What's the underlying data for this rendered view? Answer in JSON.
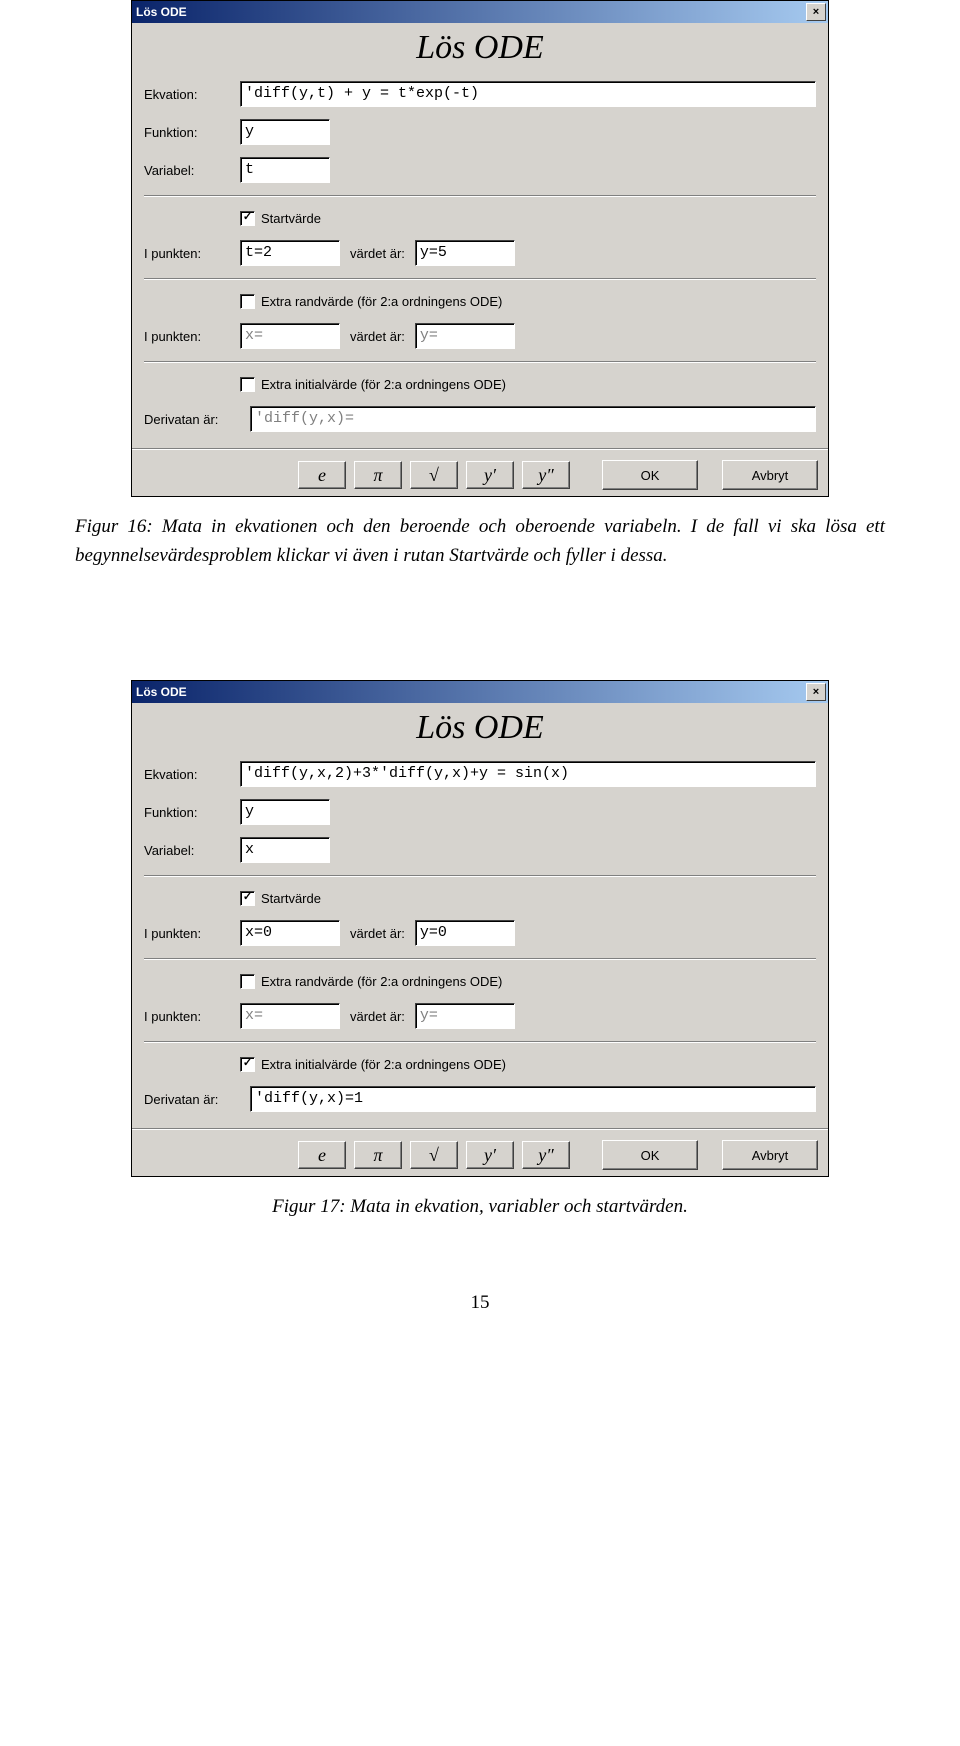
{
  "dlg1": {
    "title": "Lös ODE",
    "close": "×",
    "heading": "Lös ODE",
    "labels": {
      "ekvation": "Ekvation:",
      "funktion": "Funktion:",
      "variabel": "Variabel:",
      "ipunkten": "I punkten:",
      "vardet": "värdet är:",
      "derivatan": "Derivatan är:"
    },
    "ekvation": "'diff(y,t) + y = t*exp(-t)",
    "funktion": "y",
    "variabel": "t",
    "startvarde": "Startvärde",
    "startvarde_checked": "✓",
    "pt1": "t=2",
    "val1": "y=5",
    "extra_rand": "Extra randvärde (för 2:a ordningens ODE)",
    "extra_rand_checked": "",
    "pt2": "x=",
    "val2": "y=",
    "extra_init": "Extra initialvärde (för 2:a ordningens ODE)",
    "extra_init_checked": "",
    "derivatan": "'diff(y,x)=",
    "buttons": {
      "e": "e",
      "pi": "π",
      "sqrt": "√",
      "yp": "y′",
      "ypp": "y″",
      "ok": "OK",
      "cancel": "Avbryt"
    }
  },
  "caption1": "Figur 16: Mata in ekvationen och den beroende och oberoende variabeln. I de fall vi ska lösa ett begynnelsevärdesproblem klickar vi även i rutan Startvärde och fyller i dessa.",
  "dlg2": {
    "title": "Lös ODE",
    "close": "×",
    "heading": "Lös ODE",
    "labels": {
      "ekvation": "Ekvation:",
      "funktion": "Funktion:",
      "variabel": "Variabel:",
      "ipunkten": "I punkten:",
      "vardet": "värdet är:",
      "derivatan": "Derivatan är:"
    },
    "ekvation": "'diff(y,x,2)+3*'diff(y,x)+y = sin(x)",
    "funktion": "y",
    "variabel": "x",
    "startvarde": "Startvärde",
    "startvarde_checked": "✓",
    "pt1": "x=0",
    "val1": "y=0",
    "extra_rand": "Extra randvärde (för 2:a ordningens ODE)",
    "extra_rand_checked": "",
    "pt2": "x=",
    "val2": "y=",
    "extra_init": "Extra initialvärde (för 2:a ordningens ODE)",
    "extra_init_checked": "✓",
    "derivatan": "'diff(y,x)=1",
    "buttons": {
      "e": "e",
      "pi": "π",
      "sqrt": "√",
      "yp": "y′",
      "ypp": "y″",
      "ok": "OK",
      "cancel": "Avbryt"
    }
  },
  "caption2": "Figur 17: Mata in ekvation, variabler och startvärden.",
  "pagenum": "15"
}
